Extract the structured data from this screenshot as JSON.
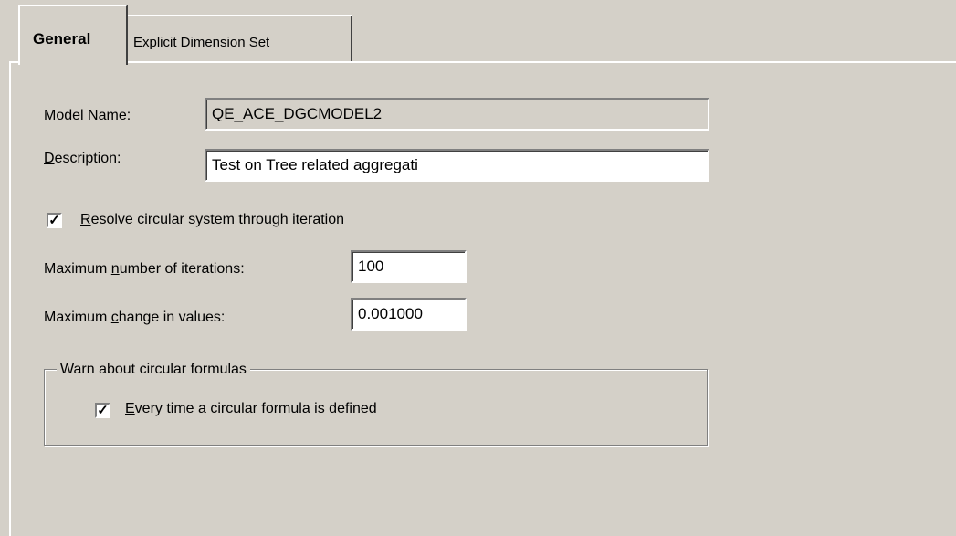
{
  "tabs": [
    {
      "label": "General",
      "active": true
    },
    {
      "label": "Explicit Dimension Set",
      "active": false
    }
  ],
  "form": {
    "model_name": {
      "label_pre": "Model ",
      "label_key": "N",
      "label_post": "ame:",
      "value": "QE_ACE_DGCMODEL2"
    },
    "description": {
      "label_pre": "",
      "label_key": "D",
      "label_post": "escription:",
      "value": "Test on Tree related aggregati"
    },
    "resolve": {
      "label_pre": "",
      "label_key": "R",
      "label_post": "esolve circular system through iteration",
      "checked": true
    },
    "max_iterations": {
      "label_pre": "Maximum ",
      "label_key": "n",
      "label_post": "umber of iterations:",
      "value": "100"
    },
    "max_change": {
      "label_pre": "Maximum ",
      "label_key": "c",
      "label_post": "hange in values:",
      "value": "0.001000"
    }
  },
  "warn_group": {
    "legend": "Warn about circular formulas",
    "every_time": {
      "label_pre": "",
      "label_key": "E",
      "label_post": "very time a circular formula is defined",
      "checked": true
    }
  },
  "check_glyph": "✓"
}
